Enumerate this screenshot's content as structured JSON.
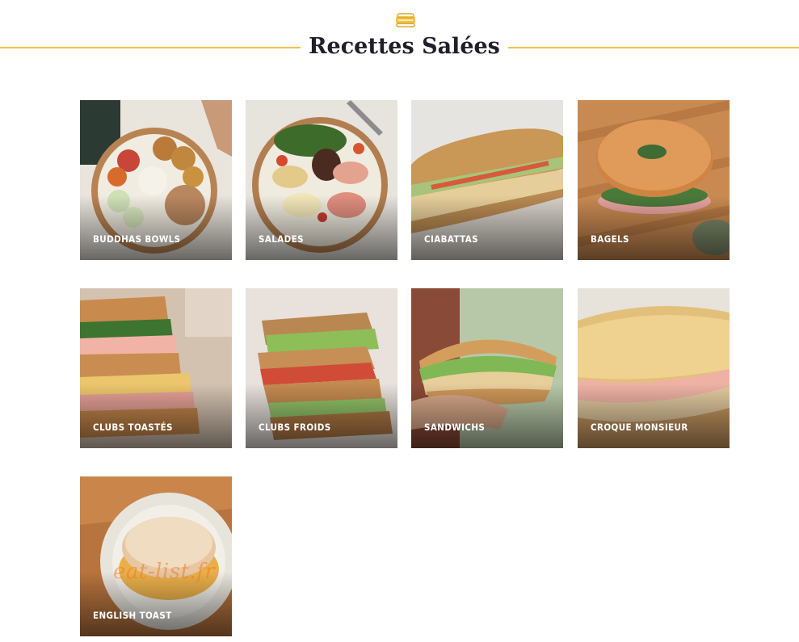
{
  "header": {
    "title": "Recettes Salées",
    "icon": "sandwich-icon",
    "line_color": "#f2c24c"
  },
  "categories": [
    {
      "label": "BUDDHAS BOWLS"
    },
    {
      "label": "SALADES"
    },
    {
      "label": "CIABATTAS"
    },
    {
      "label": "BAGELS"
    },
    {
      "label": "CLUBS TOASTÉS"
    },
    {
      "label": "CLUBS FROIDS"
    },
    {
      "label": "SANDWICHS"
    },
    {
      "label": "CROQUE MONSIEUR"
    },
    {
      "label": "ENGLISH TOAST"
    }
  ],
  "watermark": "eat-list.fr"
}
